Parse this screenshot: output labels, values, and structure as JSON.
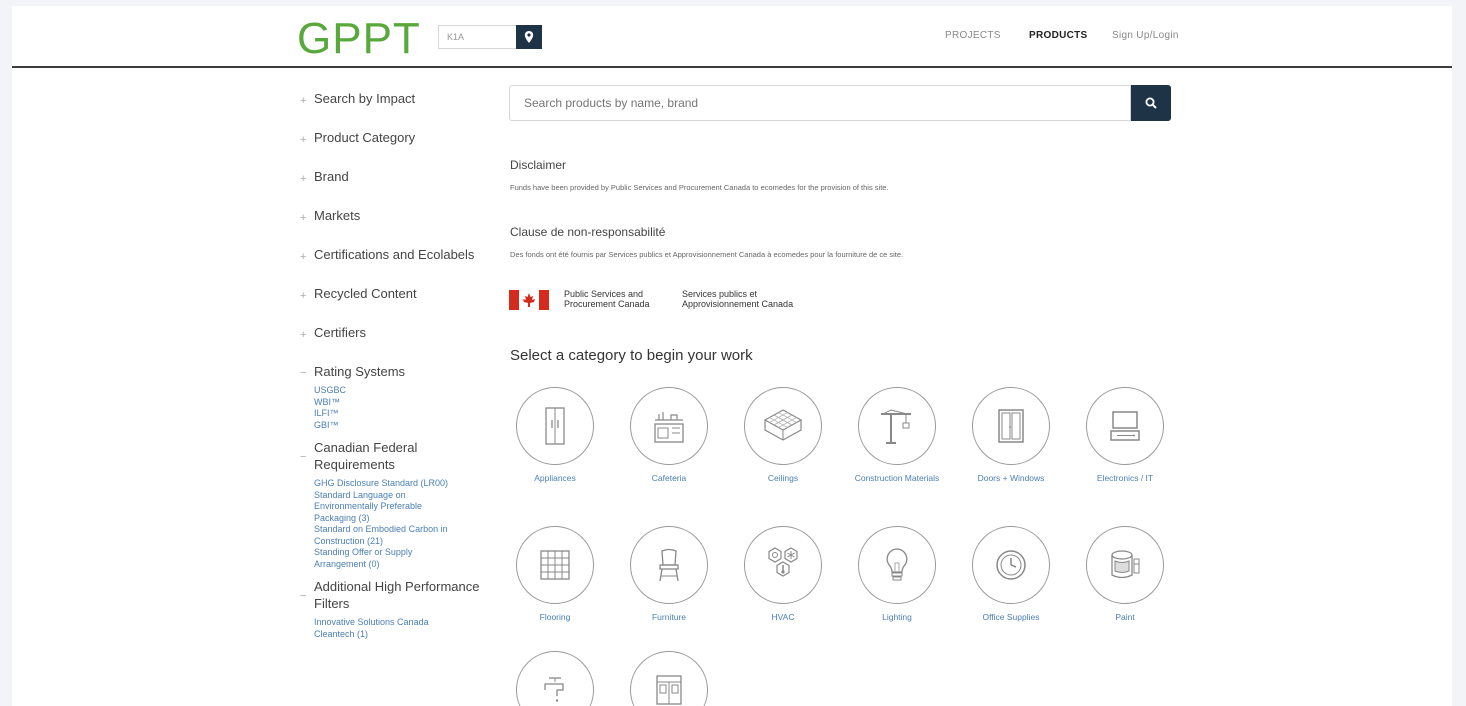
{
  "header": {
    "logo": "GPPT",
    "location_value": "K1A",
    "nav": {
      "projects": "PROJECTS",
      "products": "PRODUCTS",
      "signup": "Sign Up/Login"
    }
  },
  "sidebar": {
    "filters": [
      "Search by Impact",
      "Product Category",
      "Brand",
      "Markets",
      "Certifications and Ecolabels",
      "Recycled Content",
      "Certifiers"
    ],
    "rating_systems": {
      "title": "Rating Systems",
      "items": [
        "USGBC",
        "WBI™",
        "ILFI™",
        "GBI™"
      ]
    },
    "canadian_requirements": {
      "title": "Canadian Federal Requirements",
      "items": [
        "GHG Disclosure Standard (LR00)",
        "Standard Language on",
        "Environmentally Preferable",
        "Packaging (3)",
        "Standard on Embodied Carbon in",
        "Construction (21)",
        "Standing Offer or Supply",
        "Arrangement (0)"
      ]
    },
    "additional_filters": {
      "title": "Additional High Performance Filters",
      "items": [
        "Innovative Solutions Canada",
        "Cleantech (1)"
      ]
    }
  },
  "search": {
    "placeholder": "Search products by name, brand"
  },
  "disclaimer": {
    "title_en": "Disclaimer",
    "text_en": "Funds have been provided by Public Services and Procurement Canada to ecomedes for the provision of this site.",
    "title_fr": "Clause de non-responsabilité",
    "text_fr": "Des fonds ont été fournis par Services publics et Approvisionnement Canada à ecomedes pour la fourniture de ce site.",
    "gov_en_1": "Public Services and",
    "gov_en_2": "Procurement Canada",
    "gov_fr_1": "Services publics et",
    "gov_fr_2": "Approvisionnement Canada"
  },
  "categories": {
    "heading": "Select a category to begin your work",
    "items": [
      {
        "label": "Appliances",
        "icon": "refrigerator-icon"
      },
      {
        "label": "Cafeteria",
        "icon": "kitchen-icon"
      },
      {
        "label": "Ceilings",
        "icon": "ceiling-grid-icon"
      },
      {
        "label": "Construction Materials",
        "icon": "crane-icon"
      },
      {
        "label": "Doors + Windows",
        "icon": "door-icon"
      },
      {
        "label": "Electronics / IT",
        "icon": "computer-icon"
      },
      {
        "label": "Flooring",
        "icon": "floor-tile-icon"
      },
      {
        "label": "Furniture",
        "icon": "chair-icon"
      },
      {
        "label": "HVAC",
        "icon": "hvac-icon"
      },
      {
        "label": "Lighting",
        "icon": "lightbulb-icon"
      },
      {
        "label": "Office Supplies",
        "icon": "clock-icon"
      },
      {
        "label": "Paint",
        "icon": "paint-can-icon"
      },
      {
        "label": "",
        "icon": "faucet-icon"
      },
      {
        "label": "",
        "icon": "cabinet-icon"
      }
    ]
  }
}
